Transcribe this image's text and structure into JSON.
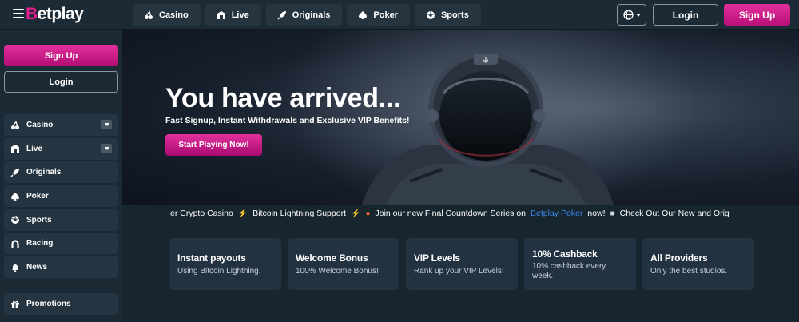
{
  "brand": {
    "logo_text": "Betplay"
  },
  "topnav": [
    {
      "label": "Casino",
      "icon": "cherry-icon"
    },
    {
      "label": "Live",
      "icon": "live-icon"
    },
    {
      "label": "Originals",
      "icon": "rocket-icon"
    },
    {
      "label": "Poker",
      "icon": "spade-icon"
    },
    {
      "label": "Sports",
      "icon": "ball-icon"
    }
  ],
  "header": {
    "login_label": "Login",
    "signup_label": "Sign Up"
  },
  "sidebar": {
    "signup_label": "Sign Up",
    "login_label": "Login",
    "items": [
      {
        "label": "Casino"
      },
      {
        "label": "Live"
      },
      {
        "label": "Originals"
      },
      {
        "label": "Poker"
      },
      {
        "label": "Sports"
      },
      {
        "label": "Racing"
      },
      {
        "label": "News"
      }
    ],
    "promotions_label": "Promotions"
  },
  "hero": {
    "title": "You have arrived...",
    "subtitle": "Fast Signup, Instant Withdrawals and Exclusive VIP Benefits!",
    "cta": "Start Playing Now!"
  },
  "ticker": {
    "part1": "er Crypto Casino",
    "part2": "Bitcoin Lightning Support",
    "part3": "Join our new Final Countdown Series on",
    "link": "Betplay Poker",
    "part4": "now!",
    "part5": "Check Out Our New and Orig"
  },
  "features": [
    {
      "title": "Instant payouts",
      "desc": "Using Bitcoin Lightning."
    },
    {
      "title": "Welcome Bonus",
      "desc": "100% Welcome Bonus!"
    },
    {
      "title": "VIP Levels",
      "desc": "Rank up your VIP Levels!"
    },
    {
      "title": "10% Cashback",
      "desc": "10% cashback every week."
    },
    {
      "title": "All Providers",
      "desc": "Only the best studios."
    }
  ],
  "colors": {
    "accent": "#e11d8f",
    "link": "#3c8bf0",
    "bg": "#17252f",
    "panel": "#1b2a35"
  }
}
